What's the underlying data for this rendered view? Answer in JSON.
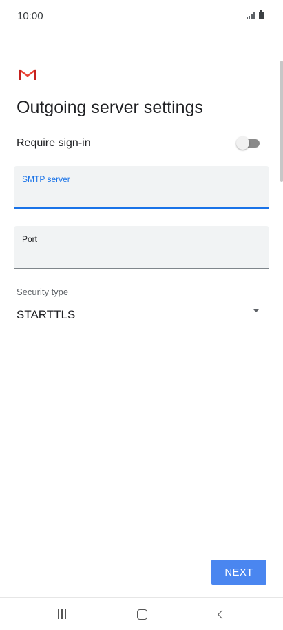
{
  "status_bar": {
    "time": "10:00",
    "icons": [
      "signal-icon",
      "battery-icon"
    ]
  },
  "app": {
    "logo": "gmail-logo",
    "brand_color": "#ea4335"
  },
  "page": {
    "title": "Outgoing server settings"
  },
  "require_signin": {
    "label": "Require sign-in",
    "enabled": false
  },
  "smtp_server": {
    "label": "SMTP server",
    "value": "",
    "focused": true
  },
  "port": {
    "label": "Port",
    "value": ""
  },
  "security_type": {
    "label": "Security type",
    "value": "STARTTLS"
  },
  "next_button": {
    "label": "NEXT"
  },
  "colors": {
    "accent": "#1a73e8",
    "button": "#4a86f0",
    "field_background": "#f1f3f4"
  },
  "nav_bar": {
    "buttons": [
      "recent-apps-icon",
      "home-icon",
      "back-icon"
    ]
  }
}
